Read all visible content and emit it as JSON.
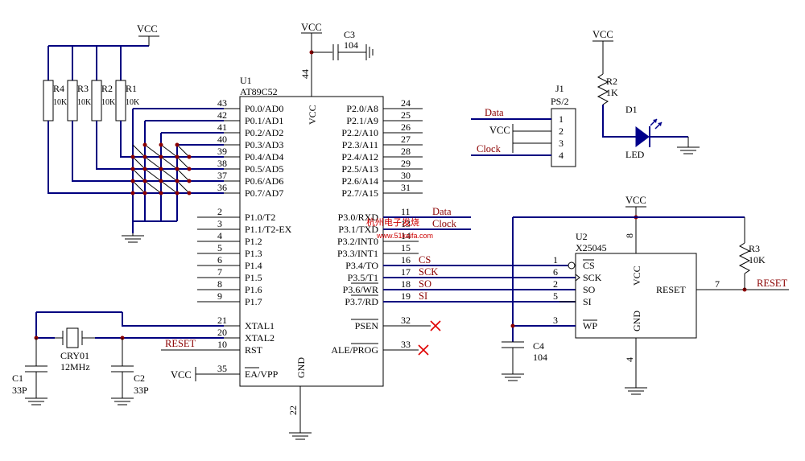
{
  "nets": {
    "vcc": "VCC",
    "data": "Data",
    "clock": "Clock",
    "reset": "RESET",
    "cs": "CS",
    "sck": "SCK",
    "so": "SO",
    "si": "SI"
  },
  "u1": {
    "ref": "U1",
    "value": "AT89C52",
    "vcc_label": "VCC",
    "vcc_pin": "44",
    "gnd_label": "GND",
    "gnd_pin": "22",
    "left_pins": [
      {
        "num": "43",
        "name": "P0.0/AD0"
      },
      {
        "num": "42",
        "name": "P0.1/AD1"
      },
      {
        "num": "41",
        "name": "P0.2/AD2"
      },
      {
        "num": "40",
        "name": "P0.3/AD3"
      },
      {
        "num": "39",
        "name": "P0.4/AD4"
      },
      {
        "num": "38",
        "name": "P0.5/AD5"
      },
      {
        "num": "37",
        "name": "P0.6/AD6"
      },
      {
        "num": "36",
        "name": "P0.7/AD7"
      },
      {
        "num": "2",
        "name": "P1.0/T2"
      },
      {
        "num": "3",
        "name": "P1.1/T2-EX"
      },
      {
        "num": "4",
        "name": "P1.2"
      },
      {
        "num": "5",
        "name": "P1.3"
      },
      {
        "num": "6",
        "name": "P1.4"
      },
      {
        "num": "7",
        "name": "P1.5"
      },
      {
        "num": "8",
        "name": "P1.6"
      },
      {
        "num": "9",
        "name": "P1.7"
      },
      {
        "num": "21",
        "name": "XTAL1"
      },
      {
        "num": "20",
        "name": "XTAL2"
      },
      {
        "num": "10",
        "name": "RST"
      },
      {
        "num": "35",
        "name": "EA/VPP"
      }
    ],
    "right_pins": [
      {
        "num": "24",
        "name": "P2.0/A8"
      },
      {
        "num": "25",
        "name": "P2.1/A9"
      },
      {
        "num": "26",
        "name": "P2.2/A10"
      },
      {
        "num": "27",
        "name": "P2.3/A11"
      },
      {
        "num": "28",
        "name": "P2.4/A12"
      },
      {
        "num": "29",
        "name": "P2.5/A13"
      },
      {
        "num": "30",
        "name": "P2.6/A14"
      },
      {
        "num": "31",
        "name": "P2.7/A15"
      },
      {
        "num": "11",
        "name": "P3.0/RXD"
      },
      {
        "num": "13",
        "name": "P3.1/TXD"
      },
      {
        "num": "14",
        "name": "P3.2/INT0"
      },
      {
        "num": "15",
        "name": "P3.3/INT1"
      },
      {
        "num": "16",
        "name": "P3.4/TO"
      },
      {
        "num": "17",
        "name": "P3.5/T1"
      },
      {
        "num": "18",
        "name": "P3.6/WR"
      },
      {
        "num": "19",
        "name": "P3.7/RD"
      },
      {
        "num": "32",
        "name": "PSEN"
      },
      {
        "num": "33",
        "name": "ALE/PROG"
      }
    ]
  },
  "u2": {
    "ref": "U2",
    "value": "X25045",
    "vcc_label": "VCC",
    "vcc_pin": "8",
    "gnd_label": "GND",
    "gnd_pin": "4",
    "pins": [
      {
        "num": "1",
        "name": "CS"
      },
      {
        "num": "6",
        "name": "SCK"
      },
      {
        "num": "2",
        "name": "SO"
      },
      {
        "num": "5",
        "name": "SI"
      },
      {
        "num": "3",
        "name": "WP"
      }
    ],
    "reset_label": "RESET",
    "reset_pin": "7"
  },
  "resistors": [
    {
      "ref": "R4",
      "value": "10K"
    },
    {
      "ref": "R3",
      "value": "10K"
    },
    {
      "ref": "R2",
      "value": "10K"
    },
    {
      "ref": "R1",
      "value": "10K"
    }
  ],
  "r2_led": {
    "ref": "R2",
    "value": "1K"
  },
  "r3_reset": {
    "ref": "R3",
    "value": "10K"
  },
  "d1": {
    "ref": "D1",
    "value": "LED"
  },
  "c1": {
    "ref": "C1",
    "value": "33P"
  },
  "c2": {
    "ref": "C2",
    "value": "33P"
  },
  "c3": {
    "ref": "C3",
    "value": "104"
  },
  "c4": {
    "ref": "C4",
    "value": "104"
  },
  "crystal": {
    "ref": "CRY01",
    "value": "12MHz"
  },
  "j1": {
    "ref": "J1",
    "value": "PS/2",
    "pins": [
      "1",
      "2",
      "3",
      "4"
    ]
  },
  "watermark": {
    "line1": "杭州电子发烧",
    "line2": "www.51kaifa.com"
  }
}
